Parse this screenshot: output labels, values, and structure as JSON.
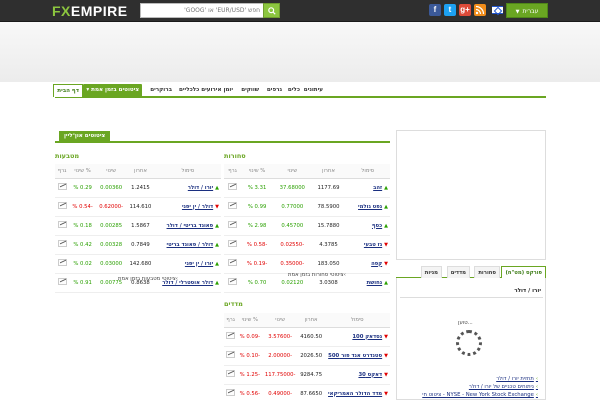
{
  "header": {
    "logo_a": "FX",
    "logo_b": "EMPIRE",
    "search_placeholder": "חפש 'EUR/USD' או 'GOOG'",
    "social": [
      "f",
      "t",
      "g+",
      "rss"
    ],
    "language": "עברית"
  },
  "nav": {
    "items": [
      {
        "label": "דף הבית",
        "active": true
      },
      {
        "label": "ציטוטים בזמן אמת",
        "highlight": true
      },
      {
        "label": "ברוקרים"
      },
      {
        "label": "יומן אירועים כלכליים"
      },
      {
        "label": "שווקים"
      },
      {
        "label": "גרפים"
      },
      {
        "label": "כלים"
      },
      {
        "label": "עיתונים"
      }
    ]
  },
  "section_tab": "ציטוטים און־ליין",
  "currencies": {
    "title": "מטבעות",
    "columns": [
      "סימול",
      "אחרון",
      "שינוי",
      "% שינוי",
      "גרף"
    ],
    "rows": [
      {
        "symbol": "יורו / דולר",
        "last": "1.2415",
        "change": "0.00360",
        "pct": "0.29 %",
        "dir": "up"
      },
      {
        "symbol": "דולר / ין יפני",
        "last": "114.610",
        "change": "-0.62000",
        "pct": "-0.54 %",
        "dir": "down"
      },
      {
        "symbol": "פאונד בריטי / דולר",
        "last": "1.5867",
        "change": "0.00285",
        "pct": "0.18 %",
        "dir": "up"
      },
      {
        "symbol": "דולר / פאונד בריטי",
        "last": "0.7849",
        "change": "0.00328",
        "pct": "0.42 %",
        "dir": "up"
      },
      {
        "symbol": "יורו / ין יפני",
        "last": "142.680",
        "change": "0.03000",
        "pct": "0.02 %",
        "dir": "up"
      },
      {
        "symbol": "דולר אוסטרלי / דולר",
        "last": "0.8638",
        "change": "0.00775",
        "pct": "0.91 %",
        "dir": "up"
      }
    ],
    "more": "ציטוטי מטבעות בזמן אמת"
  },
  "commodities": {
    "title": "סחורות",
    "columns": [
      "סימול",
      "אחרון",
      "שינוי",
      "% שינוי",
      "גרף"
    ],
    "rows": [
      {
        "symbol": "זהב",
        "last": "1177.69",
        "change": "37.68000",
        "pct": "3.31 %",
        "dir": "up"
      },
      {
        "symbol": "נפט גולמי",
        "last": "78.5900",
        "change": "0.77000",
        "pct": "0.99 %",
        "dir": "up"
      },
      {
        "symbol": "כסף",
        "last": "15.7880",
        "change": "0.45700",
        "pct": "2.98 %",
        "dir": "up"
      },
      {
        "symbol": "גז טבעי",
        "last": "4.3785",
        "change": "-0.02550",
        "pct": "-0.58 %",
        "dir": "down"
      },
      {
        "symbol": "קפה",
        "last": "183.050",
        "change": "-0.35000",
        "pct": "-0.19 %",
        "dir": "down"
      },
      {
        "symbol": "נחושת",
        "last": "3.0308",
        "change": "0.02120",
        "pct": "0.70 %",
        "dir": "up"
      }
    ],
    "more": "ציטוטי סחורות בזמן אמת"
  },
  "indices": {
    "title": "מדדים",
    "columns": [
      "סימול",
      "אחרון",
      "שינוי",
      "% שינוי",
      "גרף"
    ],
    "rows": [
      {
        "symbol": "נסדאק 100",
        "last": "4160.50",
        "change": "-3.57600",
        "pct": "-0.09 %",
        "dir": "down"
      },
      {
        "symbol": "סטנדרט אנד פור 500",
        "last": "2026.50",
        "change": "-2.00000",
        "pct": "-0.10 %",
        "dir": "down"
      },
      {
        "symbol": "דאקס 30",
        "last": "9284.75",
        "change": "-117.75000",
        "pct": "-1.25 %",
        "dir": "down"
      },
      {
        "symbol": "מדד הדולר האמריקאי",
        "last": "87.6650",
        "change": "-0.49000",
        "pct": "-0.56 %",
        "dir": "down"
      }
    ]
  },
  "sidebar": {
    "tabs": [
      "פורקס (מט\"ח)",
      "סחורות",
      "מדדים",
      "מניות"
    ],
    "selected": "יורו / דולר",
    "loading": "טוען...",
    "links": [
      "תחזית יורו / דולר",
      "ניתוחים טכניים של יורו / דולר",
      "NYSE - New York Stock Exchange - ציטוט חי"
    ]
  },
  "colors": {
    "accent": "#6aa622",
    "positive": "#2aa000",
    "negative": "#e10000",
    "topbar": "#2f2f2f"
  }
}
